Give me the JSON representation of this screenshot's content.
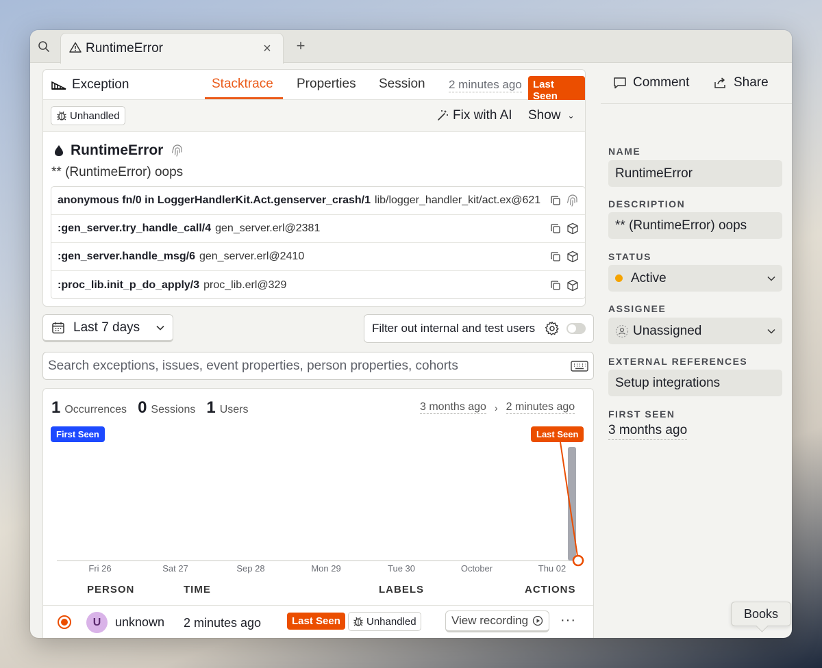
{
  "tabbar": {
    "tab_title": "RuntimeError",
    "close_glyph": "×",
    "add_glyph": "+"
  },
  "exception": {
    "header_label": "Exception",
    "tabs": [
      "Stacktrace",
      "Properties",
      "Session"
    ],
    "active_tab": "Stacktrace",
    "time_ago": "2 minutes ago",
    "last_seen_badge": "Last Seen",
    "unhandled_badge": "Unhandled",
    "fix_ai_label": "Fix with AI",
    "show_label": "Show",
    "error_type": "RuntimeError",
    "error_message": "** (RuntimeError) oops",
    "frames": [
      {
        "fn": "anonymous fn/0 in LoggerHandlerKit.Act.genserver_crash/1",
        "file": "lib/logger_handler_kit/act.ex@621",
        "icon": "fingerprint-icon"
      },
      {
        "fn": ":gen_server.try_handle_call/4",
        "file": "gen_server.erl@2381",
        "icon": "cube-icon"
      },
      {
        "fn": ":gen_server.handle_msg/6",
        "file": "gen_server.erl@2410",
        "icon": "cube-icon"
      },
      {
        "fn": ":proc_lib.init_p_do_apply/3",
        "file": "proc_lib.erl@329",
        "icon": "cube-icon"
      }
    ]
  },
  "filters": {
    "date_range": "Last 7 days",
    "filter_internal": "Filter out internal and test users",
    "filter_internal_enabled": false,
    "search_placeholder": "Search exceptions, issues, event properties, person properties, cohorts"
  },
  "stats": {
    "occurrences": "1",
    "occurrences_label": "Occurrences",
    "sessions": "0",
    "sessions_label": "Sessions",
    "users": "1",
    "users_label": "Users",
    "range_start": "3 months ago",
    "range_arrow": "›",
    "range_end": "2 minutes ago"
  },
  "chart_data": {
    "type": "bar",
    "categories": [
      "Fri 26",
      "Sat 27",
      "Sep 28",
      "Mon 29",
      "Tue 30",
      "October",
      "Thu 02"
    ],
    "values": [
      0,
      0,
      0,
      0,
      0,
      0,
      1
    ],
    "first_seen_label": "First Seen",
    "last_seen_label": "Last Seen",
    "colors": {
      "bar": "#a6a8b0",
      "last_seen": "#eb4e00",
      "first_seen": "#1d4aff"
    }
  },
  "table": {
    "headers": [
      "PERSON",
      "TIME",
      "LABELS",
      "ACTIONS"
    ],
    "rows": [
      {
        "avatar": "U",
        "person": "unknown",
        "time": "2 minutes ago",
        "label_last_seen": "Last Seen",
        "label_unhandled": "Unhandled",
        "action": "View recording",
        "more": "···"
      }
    ]
  },
  "sidebar": {
    "comment_label": "Comment",
    "share_label": "Share",
    "name_label": "NAME",
    "name_value": "RuntimeError",
    "description_label": "DESCRIPTION",
    "description_value": "** (RuntimeError) oops",
    "status_label": "STATUS",
    "status_value": "Active",
    "assignee_label": "ASSIGNEE",
    "assignee_value": "Unassigned",
    "external_label": "EXTERNAL REFERENCES",
    "external_value": "Setup integrations",
    "first_seen_label": "FIRST SEEN",
    "first_seen_value": "3 months ago"
  },
  "tooltip": {
    "text": "Books"
  }
}
